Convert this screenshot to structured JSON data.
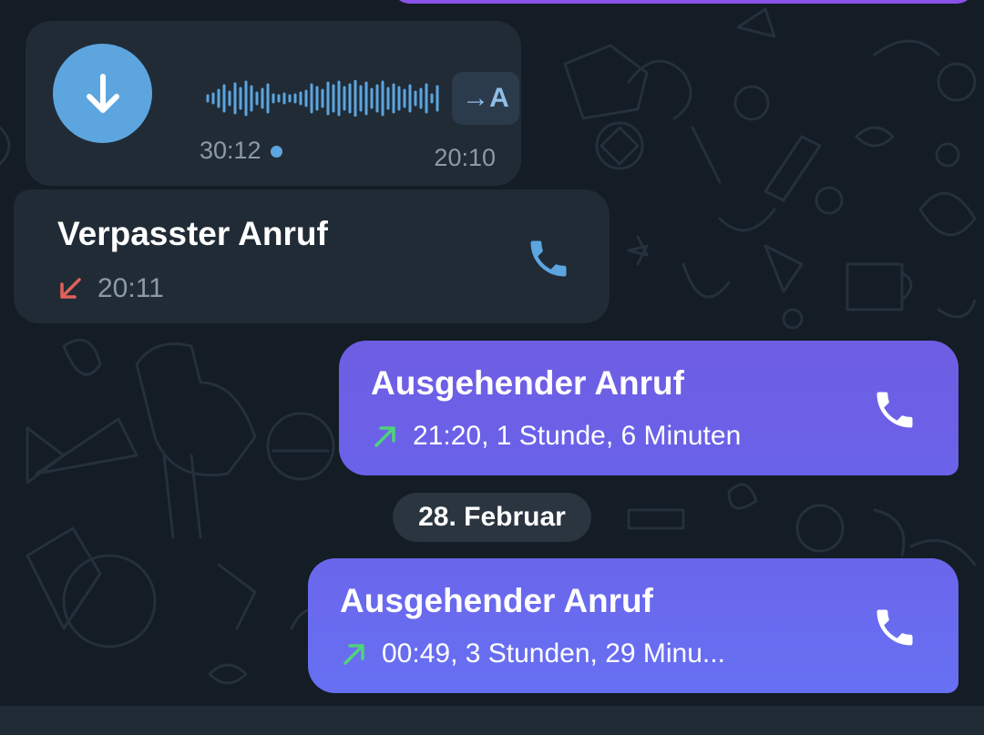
{
  "colors": {
    "background": "#141c25",
    "incoming_bubble": "#202b36",
    "outgoing_bubble": "#6e5ee3",
    "accent_blue": "#5ca5df",
    "missed_red": "#e0625b",
    "outgoing_green": "#4fd27a",
    "meta_grey": "#8c9aa8"
  },
  "voice_message": {
    "download_icon": "arrow-down-icon",
    "transcribe_label": "→A",
    "duration": "30:12",
    "time": "20:10"
  },
  "missed_call": {
    "title": "Verpasster Anruf",
    "direction_icon": "arrow-down-left-icon",
    "time": "20:11",
    "call_icon": "phone-icon"
  },
  "outgoing_call_1": {
    "title": "Ausgehender Anruf",
    "direction_icon": "arrow-up-right-icon",
    "details": "21:20, 1 Stunde, 6 Minuten",
    "call_icon": "phone-icon"
  },
  "date_separator": {
    "label": "28. Februar"
  },
  "outgoing_call_2": {
    "title": "Ausgehender Anruf",
    "direction_icon": "arrow-up-right-icon",
    "details": "00:49, 3 Stunden, 29 Minu...",
    "call_icon": "phone-icon"
  }
}
